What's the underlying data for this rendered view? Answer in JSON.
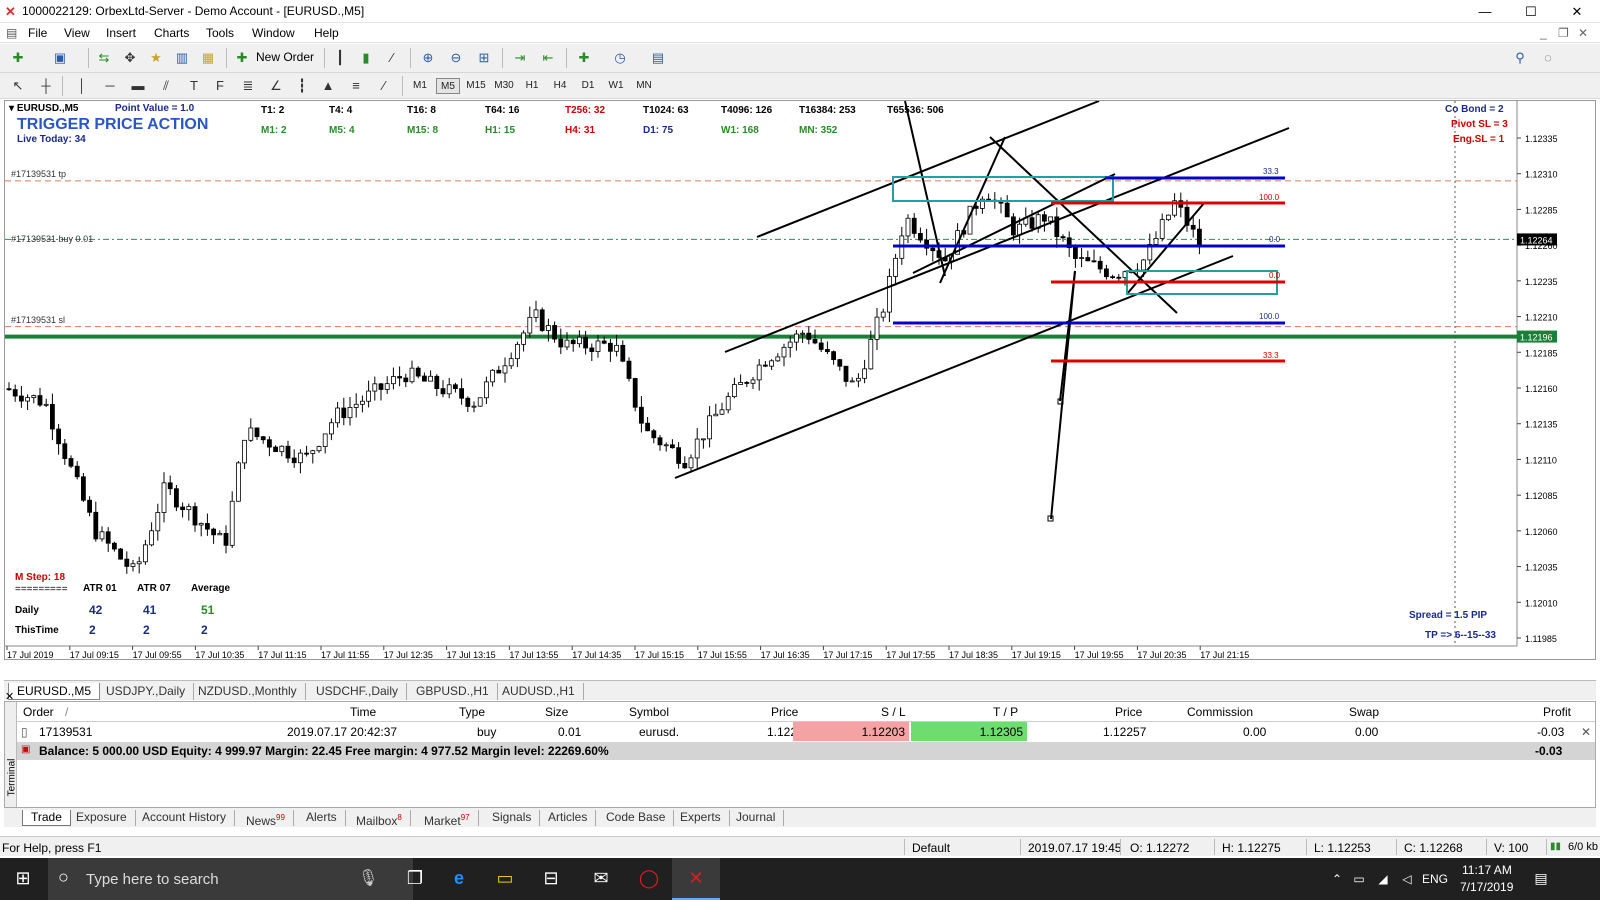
{
  "window": {
    "title": "1000022129: OrbexLtd-Server - Demo Account - [EURUSD.,M5]",
    "min": "—",
    "max": "☐",
    "close": "✕"
  },
  "menu": [
    "File",
    "View",
    "Insert",
    "Charts",
    "Tools",
    "Window",
    "Help"
  ],
  "toolbar": {
    "new_order": "New Order"
  },
  "timeframes": [
    "M1",
    "M5",
    "M15",
    "M30",
    "H1",
    "H4",
    "D1",
    "W1",
    "MN"
  ],
  "active_timeframe": "M5",
  "chart": {
    "symbol": "EURUSD.,M5",
    "point_value": "Point Value = 1.0",
    "trigger": "TRIGGER PRICE ACTION",
    "live_today": "Live Today: 34",
    "t_row1": [
      "T1: 2",
      "T4: 4",
      "T16: 8",
      "T64: 16",
      "T256: 32",
      "T1024: 63",
      "T4096: 126",
      "T16384: 253",
      "T65536: 506"
    ],
    "t_row2": [
      "M1: 2",
      "M5: 4",
      "M15: 8",
      "H1: 15",
      "H4: 31",
      "D1: 75",
      "W1: 168",
      "MN: 352"
    ],
    "right_labels": [
      "Co Bond = 2",
      "Pivot SL = 3",
      "Eng.SL = 1"
    ],
    "order_labels": {
      "tp": "#17139531 tp",
      "buy": "#17139531 buy 0.01",
      "sl": "#17139531 sl"
    },
    "fib_labels": [
      "33.3",
      "100.0",
      "0.0",
      "0.0",
      "100.0",
      "33.3"
    ],
    "m_step": "M Step: 18",
    "atr": {
      "sep": "=========",
      "headers": [
        "ATR 01",
        "ATR 07",
        "Average"
      ],
      "daily_label": "Daily",
      "daily": [
        "42",
        "41",
        "51"
      ],
      "thistime_label": "ThisTime",
      "thistime": [
        "2",
        "2",
        "2"
      ]
    },
    "spread": "Spread = 1.5 PIP",
    "tp_text": "TP => 6--15--33",
    "price_axis": [
      "1.12335",
      "1.12310",
      "1.12285",
      "1.12260",
      "1.12235",
      "1.12210",
      "1.12185",
      "1.12160",
      "1.12135",
      "1.12110",
      "1.12085",
      "1.12060",
      "1.12035",
      "1.12010",
      "1.11985"
    ],
    "bid_price": "1.12264",
    "green_price": "1.12196",
    "time_axis": [
      "17 Jul 2019",
      "17 Jul 09:15",
      "17 Jul 09:55",
      "17 Jul 10:35",
      "17 Jul 11:15",
      "17 Jul 11:55",
      "17 Jul 12:35",
      "17 Jul 13:15",
      "17 Jul 13:55",
      "17 Jul 14:35",
      "17 Jul 15:15",
      "17 Jul 15:55",
      "17 Jul 16:35",
      "17 Jul 17:15",
      "17 Jul 17:55",
      "17 Jul 18:35",
      "17 Jul 19:15",
      "17 Jul 19:55",
      "17 Jul 20:35",
      "17 Jul 21:15"
    ],
    "colors": {
      "trendline": "#000000",
      "blue_level": "#0000cc",
      "red_level": "#dd0000",
      "green_level": "#1a7f37",
      "box": "#20a0a0",
      "tp_dash": "#e07a5f",
      "bid_dash": "#2e8b57"
    }
  },
  "chart_tabs": [
    "EURUSD.,M5",
    "USDJPY.,Daily",
    "NZDUSD.,Monthly",
    "USDCHF.,Daily",
    "GBPUSD.,H1",
    "AUDUSD.,H1"
  ],
  "terminal": {
    "side_label": "Terminal",
    "headers": [
      "Order",
      "/",
      "Time",
      "Type",
      "Size",
      "Symbol",
      "Price",
      "S / L",
      "T / P",
      "Price",
      "Commission",
      "Swap",
      "Profit"
    ],
    "row": {
      "order": "17139531",
      "time": "2019.07.17 20:42:37",
      "type": "buy",
      "size": "0.01",
      "symbol": "eurusd.",
      "price": "1.12260",
      "sl": "1.12203",
      "tp": "1.12305",
      "cur_price": "1.12257",
      "commission": "0.00",
      "swap": "0.00",
      "profit": "-0.03"
    },
    "balance": "Balance: 5 000.00 USD  Equity: 4 999.97  Margin: 22.45  Free margin: 4 977.52  Margin level: 22269.60%",
    "balance_profit": "-0.03"
  },
  "terminal_tabs": [
    {
      "label": "Trade",
      "badge": ""
    },
    {
      "label": "Exposure",
      "badge": ""
    },
    {
      "label": "Account History",
      "badge": ""
    },
    {
      "label": "News",
      "badge": "99"
    },
    {
      "label": "Alerts",
      "badge": ""
    },
    {
      "label": "Mailbox",
      "badge": "8"
    },
    {
      "label": "Market",
      "badge": "97"
    },
    {
      "label": "Signals",
      "badge": ""
    },
    {
      "label": "Articles",
      "badge": ""
    },
    {
      "label": "Code Base",
      "badge": ""
    },
    {
      "label": "Experts",
      "badge": ""
    },
    {
      "label": "Journal",
      "badge": ""
    }
  ],
  "status": {
    "help": "For Help, press F1",
    "profile": "Default",
    "datetime": "2019.07.17 19:45",
    "o": "O: 1.12272",
    "h": "H: 1.12275",
    "l": "L: 1.12253",
    "c": "C: 1.12268",
    "v": "V: 100",
    "traffic": "6/0 kb"
  },
  "taskbar": {
    "search_placeholder": "Type here to search",
    "lang": "ENG",
    "time": "11:17 AM",
    "date": "7/17/2019"
  }
}
